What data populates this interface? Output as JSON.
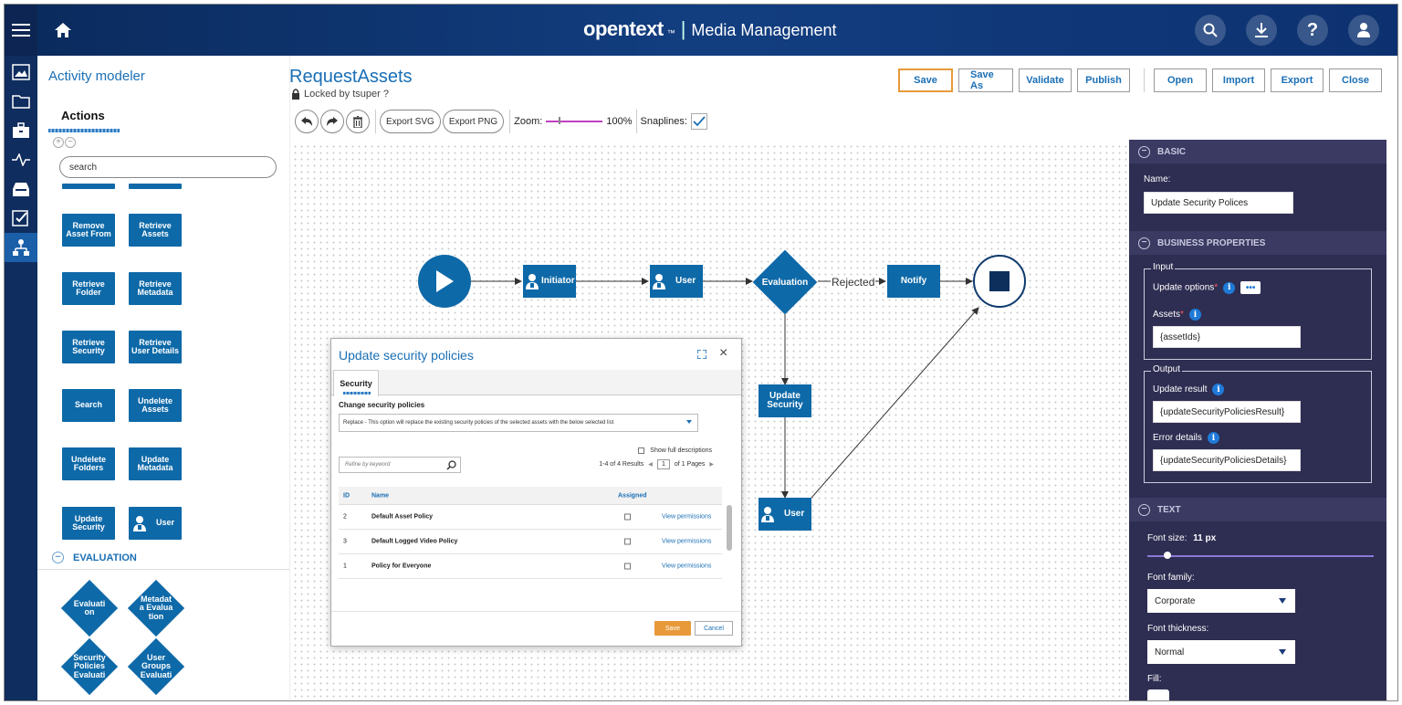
{
  "header": {
    "brand": "opentext",
    "brand_tm": "™",
    "separator": "|",
    "product": "Media Management",
    "icons": [
      "search-icon",
      "download-icon",
      "help-icon",
      "user-icon"
    ]
  },
  "rail": {
    "items": [
      "menu-icon",
      "image-icon",
      "folder-icon",
      "briefcase-icon",
      "activity-icon",
      "inbox-icon",
      "checklist-icon",
      "workflow-icon"
    ]
  },
  "left_panel": {
    "title": "Activity modeler",
    "tab": "Actions",
    "search_value": "search",
    "tiles": [
      {
        "label": "Remove Asset From"
      },
      {
        "label": "Retrieve Assets"
      },
      {
        "label": "Retrieve Folder"
      },
      {
        "label": "Retrieve Metadata"
      },
      {
        "label": "Retrieve Security"
      },
      {
        "label": "Retrieve User Details"
      },
      {
        "label": "Search"
      },
      {
        "label": "Undelete Assets"
      },
      {
        "label": "Undelete Folders"
      },
      {
        "label": "Update Metadata"
      },
      {
        "label": "Update Security"
      },
      {
        "label": "User"
      }
    ],
    "evaluation_section": "EVALUATION",
    "evaluations": [
      {
        "label": "Evaluati on"
      },
      {
        "label": "Metadat a Evalua tion"
      },
      {
        "label": "Security Policies Evaluati"
      },
      {
        "label": "User Groups Evaluati"
      }
    ]
  },
  "document": {
    "title": "RequestAssets",
    "locked_text": "Locked by tsuper ?"
  },
  "toolbar": {
    "export_svg": "Export SVG",
    "export_png": "Export PNG",
    "zoom_label": "Zoom:",
    "zoom_value": "100%",
    "snaplines_label": "Snaplines:"
  },
  "actions": {
    "save": "Save",
    "save_as": "Save As",
    "validate": "Validate",
    "publish": "Publish",
    "open": "Open",
    "import": "Import",
    "export": "Export",
    "close": "Close"
  },
  "flow": {
    "initiator": "Initiator",
    "user1": "User",
    "evaluation": "Evaluation",
    "rejected": "Rejected",
    "notify": "Notify",
    "update_security": "Update Security",
    "user2": "User"
  },
  "dialog": {
    "title": "Update security policies",
    "tab": "Security",
    "change_label": "Change security policies",
    "select_value": "Replace - This option will replace the existing security policies of the selected assets with the below selected list",
    "show_full": "Show full descriptions",
    "refine_placeholder": "Refine by keyword",
    "results": "1-4 of 4 Results",
    "page": "1",
    "of_pages": "of 1 Pages",
    "columns": {
      "id": "ID",
      "name": "Name",
      "assigned": "Assigned"
    },
    "rows": [
      {
        "id": "2",
        "name": "Default Asset Policy",
        "link": "View permissions"
      },
      {
        "id": "3",
        "name": "Default Logged Video Policy",
        "link": "View permissions"
      },
      {
        "id": "1",
        "name": "Policy for Everyone",
        "link": "View permissions"
      }
    ],
    "save": "Save",
    "cancel": "Cancel"
  },
  "properties": {
    "basic_header": "BASIC",
    "name_label": "Name:",
    "name_value": "Update Security Polices",
    "business_header": "BUSINESS PROPERTIES",
    "input_legend": "Input",
    "update_options_label": "Update options",
    "assets_label": "Assets",
    "required_mark": "*",
    "assets_value": "{assetIds}",
    "output_legend": "Output",
    "update_result_label": "Update result",
    "update_result_value": "{updateSecurityPoliciesResult}",
    "error_details_label": "Error details",
    "error_details_value": "{updateSecurityPoliciesDetails}",
    "text_header": "TEXT",
    "font_size_label": "Font size:",
    "font_size_value": "11 px",
    "font_family_label": "Font family:",
    "font_family_value": "Corporate",
    "font_thickness_label": "Font thickness:",
    "font_thickness_value": "Normal",
    "fill_label": "Fill:"
  },
  "colors": {
    "header_bg": "#123e80",
    "accent_blue": "#0e69a8",
    "link_blue": "#1a6fb5",
    "save_orange": "#e89a3a",
    "panel_dark": "#2e2d52"
  }
}
